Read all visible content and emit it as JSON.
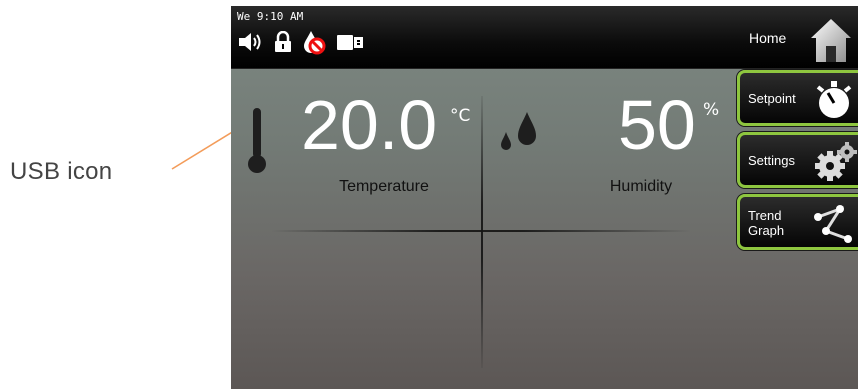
{
  "annotation": {
    "label": "USB icon",
    "arrow_color": "#f39c5a"
  },
  "status_bar": {
    "datetime": "We 9:10 AM",
    "icons": [
      "speaker-icon",
      "lock-icon",
      "no-water-icon",
      "usb-icon"
    ],
    "home_label": "Home"
  },
  "temperature": {
    "value": "20.0",
    "unit": "°C",
    "label": "Temperature"
  },
  "humidity": {
    "value": "50",
    "unit": "%",
    "label": "Humidity"
  },
  "buttons": {
    "setpoint": "Setpoint",
    "settings": "Settings",
    "trend_line1": "Trend",
    "trend_line2": "Graph"
  },
  "colors": {
    "button_border": "#8ec63f",
    "topbar": "#000000",
    "panel": "#7e8983"
  }
}
